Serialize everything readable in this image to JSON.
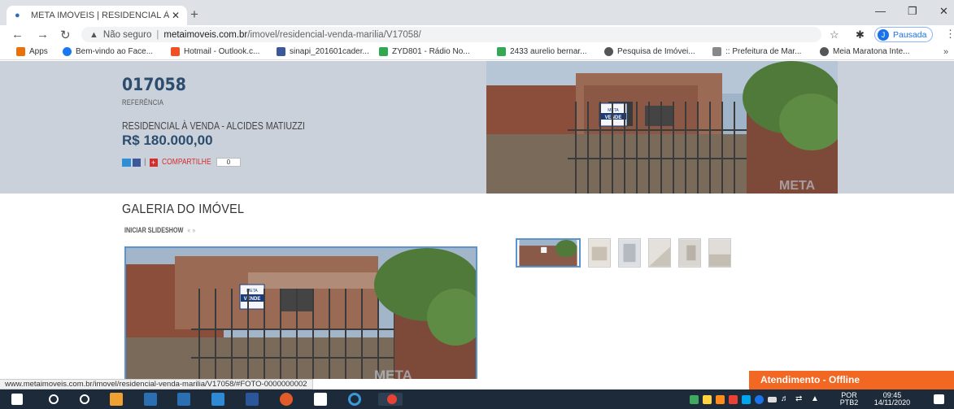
{
  "browser": {
    "tab_title": "META IMÓVEIS | RESIDENCIAL À",
    "not_secure": "Não seguro",
    "url_host": "metaimoveis.com.br",
    "url_path": "/imovel/residencial-venda-marilia/V17058/",
    "profile_initial": "J",
    "profile_label": "Pausada"
  },
  "bookmarks": [
    {
      "label": "Apps",
      "color": "#e8710a"
    },
    {
      "label": "Bem-vindo ao Face...",
      "color": "#1877f2"
    },
    {
      "label": "Hotmail - Outlook.c...",
      "color": "#f25022"
    },
    {
      "label": "sinapi_201601cader...",
      "color": "#3b5998"
    },
    {
      "label": "ZYD801 - Rádio No...",
      "color": "#2fa84f"
    },
    {
      "label": "2433 aurelio bernar...",
      "color": "#34a853"
    },
    {
      "label": "Pesquisa de Imóvei...",
      "color": "#555555"
    },
    {
      "label": ":: Prefeitura de Mar...",
      "color": "#888888"
    },
    {
      "label": "Meia Maratona Inte...",
      "color": "#555555"
    }
  ],
  "property": {
    "reference": "017058",
    "reference_label": "REFERÊNCIA",
    "title": "RESIDENCIAL À VENDA - ALCIDES MATIUZZI",
    "price": "R$ 180.000,00",
    "share_label": "COMPARTILHE",
    "share_count": "0"
  },
  "gallery": {
    "title": "GALERIA DO IMÓVEL",
    "slideshow_label": "INICIAR SLIDESHOW",
    "arrows": "« »",
    "sign_brand": "META",
    "sign_text": "VENDE",
    "watermark": "META"
  },
  "status_bar": "www.metaimoveis.com.br/imovel/residencial-venda-marilia/V17058/#FOTO-0000000002",
  "chat_label": "Atendimento - Offline",
  "taskbar": {
    "lang1": "POR",
    "lang2": "PTB2",
    "time": "09:45",
    "date": "14/11/2020"
  }
}
